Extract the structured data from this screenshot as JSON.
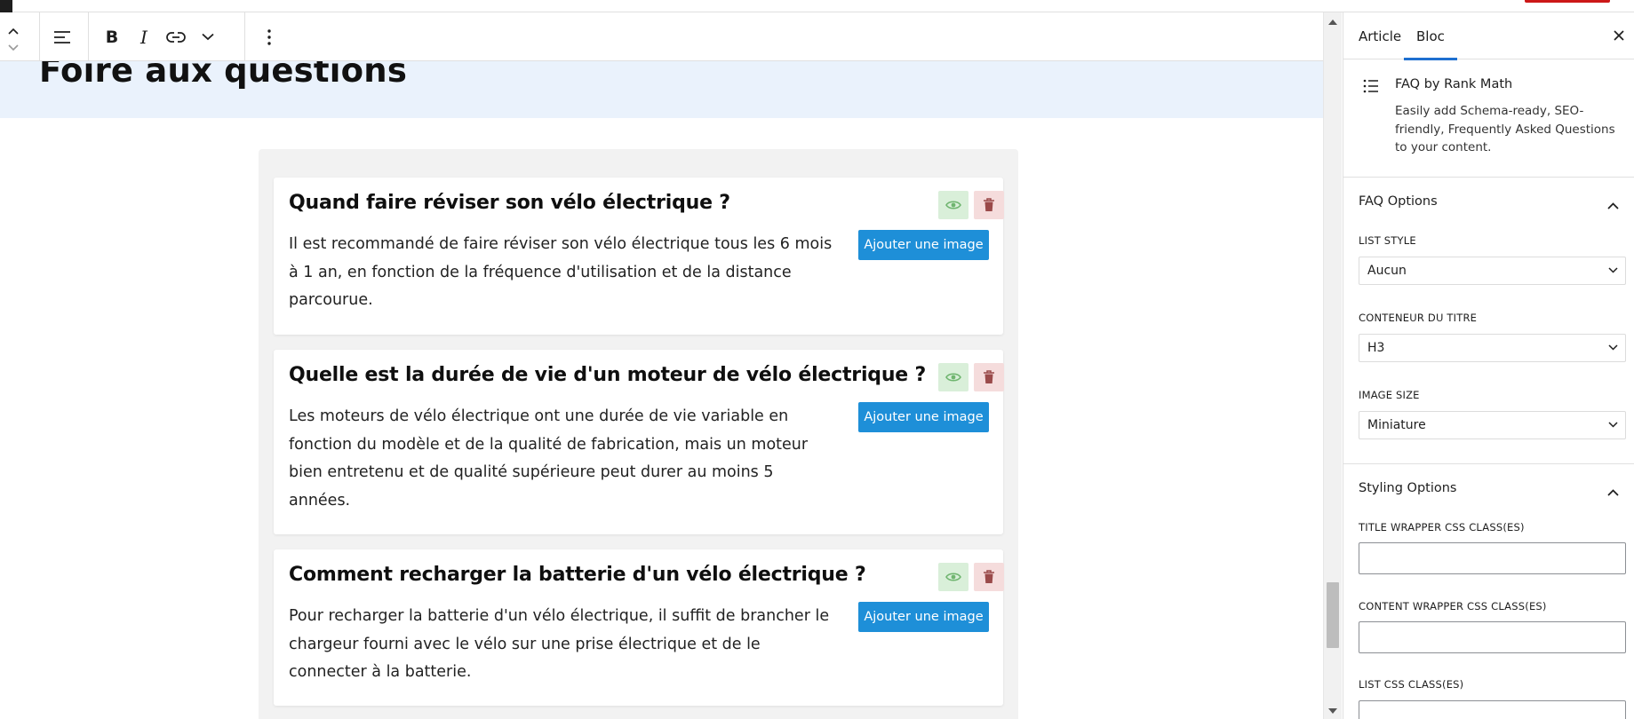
{
  "toolbar": {
    "move_up_icon": "chevron-up-icon",
    "move_down_icon": "chevron-down-icon",
    "align_icon": "align-left-icon",
    "bold_label": "B",
    "italic_label": "I",
    "link_icon": "link-icon",
    "more_icon": "chevron-down-icon",
    "options_icon": "vertical-ellipsis-icon"
  },
  "page": {
    "title": "Foire aux questions"
  },
  "faq": {
    "items": [
      {
        "question": "Quand faire réviser son vélo électrique ?",
        "answer": "Il est recommandé de faire réviser son vélo électrique tous les 6 mois à 1 an, en fonction de la fréquence d'utilisation et de la distance parcourue.",
        "add_image_label": "Ajouter une image"
      },
      {
        "question": "Quelle est la durée de vie d'un moteur de vélo électrique ?",
        "answer": "Les moteurs de vélo électrique ont une durée de vie variable en fonction du modèle et de la qualité de fabrication, mais un moteur bien entretenu et de qualité supérieure peut durer au moins 5 années.",
        "add_image_label": "Ajouter une image"
      },
      {
        "question": "Comment recharger la batterie d'un vélo électrique ?",
        "answer": "Pour recharger la batterie d'un vélo électrique, il suffit de brancher le chargeur fourni avec le vélo sur une prise électrique et de le connecter à la batterie.",
        "add_image_label": "Ajouter une image"
      }
    ]
  },
  "sidebar": {
    "tabs": [
      {
        "label": "Article",
        "active": false
      },
      {
        "label": "Bloc",
        "active": true
      }
    ],
    "close_icon": "close-icon",
    "block": {
      "icon": "list-icon",
      "title": "FAQ by Rank Math",
      "description": "Easily add Schema-ready, SEO-friendly, Frequently Asked Questions to your content."
    },
    "faq_options": {
      "title": "FAQ Options",
      "list_style_label": "LIST STYLE",
      "list_style_value": "Aucun",
      "title_wrapper_label": "CONTENEUR DU TITRE",
      "title_wrapper_value": "H3",
      "image_size_label": "IMAGE SIZE",
      "image_size_value": "Miniature"
    },
    "styling_options": {
      "title": "Styling Options",
      "title_wrapper_css_label": "TITLE WRAPPER CSS CLASS(ES)",
      "title_wrapper_css_value": "",
      "content_wrapper_css_label": "CONTENT WRAPPER CSS CLASS(ES)",
      "content_wrapper_css_value": "",
      "list_css_label": "LIST CSS CLASS(ES)",
      "list_css_value": ""
    }
  },
  "colors": {
    "accent": "#1e8fd8",
    "tab_underline": "#1e6fd0",
    "title_band": "#eaf2fc",
    "eye_bg": "#d9efd9",
    "trash_bg": "#f5dcdc"
  }
}
